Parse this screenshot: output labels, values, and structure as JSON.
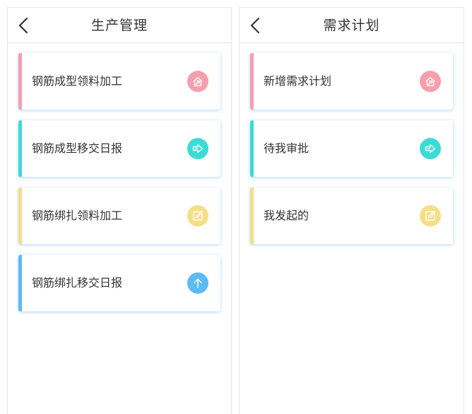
{
  "left_screen": {
    "title": "生产管理",
    "items": [
      {
        "label": "钢筋成型领料加工",
        "accent": "#f59fae",
        "icon": "house-arrow-icon"
      },
      {
        "label": "钢筋成型移交日报",
        "accent": "#3ddbd5",
        "icon": "arrow-right-icon"
      },
      {
        "label": "钢筋绑扎领料加工",
        "accent": "#f5de86",
        "icon": "edit-icon"
      },
      {
        "label": "钢筋绑扎移交日报",
        "accent": "#5bbbf4",
        "icon": "arrow-up-icon"
      }
    ]
  },
  "right_screen": {
    "title": "需求计划",
    "items": [
      {
        "label": "新增需求计划",
        "accent": "#f59fae",
        "icon": "house-arrow-icon"
      },
      {
        "label": "待我审批",
        "accent": "#3ddbd5",
        "icon": "arrow-right-icon"
      },
      {
        "label": "我发起的",
        "accent": "#f5de86",
        "icon": "edit-icon"
      }
    ]
  }
}
